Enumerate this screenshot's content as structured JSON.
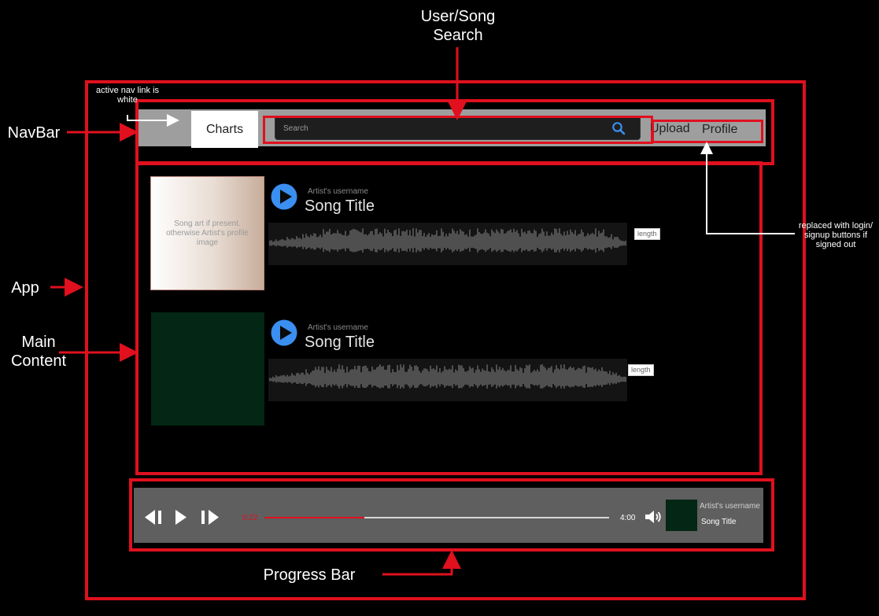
{
  "annotations": {
    "search_title": "User/Song\nSearch",
    "navbar": "NavBar",
    "app": "App",
    "main_content": "Main\nContent",
    "progress_bar": "Progress Bar",
    "active_nav_note": "active nav link is\nwhite",
    "signed_out_note": "replaced with login/\nsignup buttons if\nsigned out"
  },
  "navbar": {
    "active_tab": "Charts",
    "search_placeholder": "Search",
    "upload_label": "Upload",
    "profile_label": "Profile"
  },
  "songs": [
    {
      "art_placeholder": "Song art if present. otherwise Artist's profile image",
      "artist": "Artist's username",
      "title": "Song Title",
      "length_label": "length"
    },
    {
      "art_placeholder": "",
      "artist": "Artist's username",
      "title": "Song Title",
      "length_label": "length"
    }
  ],
  "player": {
    "current_time": "0:22",
    "total_time": "4:00",
    "progress_fraction": 0.29,
    "artist": "Artist's username",
    "title": "Song Title"
  },
  "colors": {
    "annotation_red": "#e0101e",
    "play_blue": "#3a8ff0",
    "navbar_gray": "#9e9e9e",
    "player_gray": "#5f5f5f"
  }
}
